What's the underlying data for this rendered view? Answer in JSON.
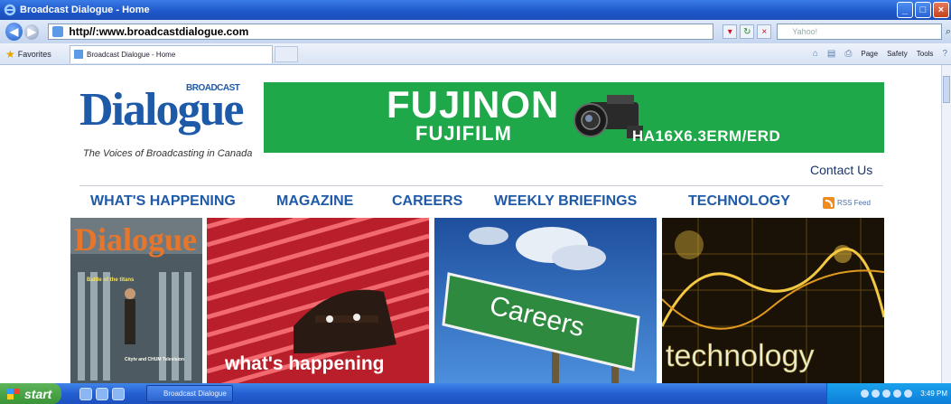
{
  "window": {
    "title": "Broadcast Dialogue - Home"
  },
  "browser": {
    "address": "http//:www.broadcastdialogue.com",
    "search_placeholder": "Yahoo!",
    "favorites_label": "Favorites",
    "tab_label": "Broadcast Dialogue - Home",
    "commands": {
      "page": "Page",
      "safety": "Safety",
      "tools": "Tools"
    }
  },
  "site": {
    "logo_small": "BROADCAST",
    "logo_word": "Dialogue",
    "tagline": "The Voices of Broadcasting in Canada",
    "banner": {
      "brand": "FUJINON",
      "sub_brand": "FUJIFILM",
      "model": "HA16X6.3ERM/ERD",
      "bg_color": "#1ea84a"
    },
    "contact": "Contact Us",
    "nav": [
      {
        "label": "WHAT'S HAPPENING"
      },
      {
        "label": "MAGAZINE"
      },
      {
        "label": "CAREERS"
      },
      {
        "label": "WEEKLY BRIEFINGS"
      },
      {
        "label": "TECHNOLOGY"
      }
    ],
    "rss": "RSS Feed",
    "tiles": {
      "magazine": {
        "title": "Dialogue",
        "cover_line_1": "Battle of the titans",
        "cover_line_2": "Citytv and CHUM Television"
      },
      "happening": {
        "caption": "what's happening"
      },
      "careers": {
        "sign": "Careers"
      },
      "technology": {
        "caption": "technology"
      }
    },
    "accent_color": "#1f5aa8"
  },
  "taskbar": {
    "start": "start",
    "item": "Broadcast Dialogue",
    "clock": "3:49 PM"
  }
}
